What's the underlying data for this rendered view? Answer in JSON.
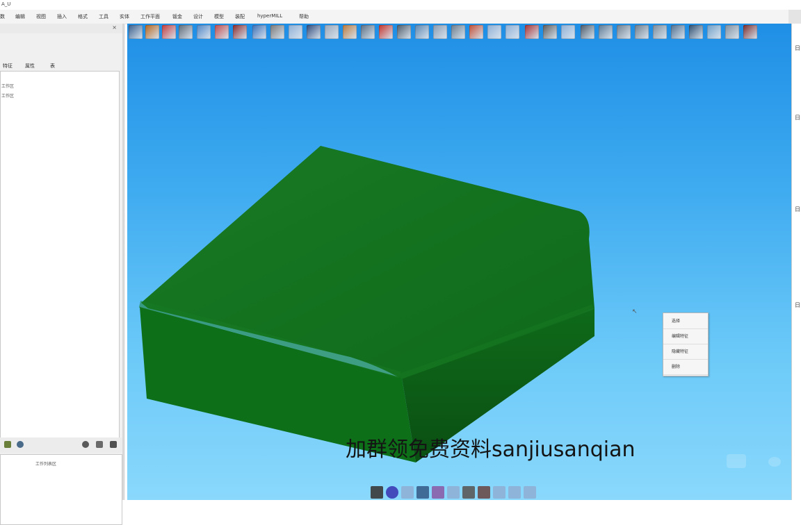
{
  "window": {
    "title": "A_U"
  },
  "menu": {
    "items": [
      "数",
      "编辑",
      "视图",
      "插入",
      "格式",
      "工具",
      "实体",
      "工作平面",
      "钣金",
      "设计",
      "模型",
      "装配",
      "hyperMILL",
      "帮助"
    ]
  },
  "left_panel": {
    "close_glyph": "×",
    "tabs": [
      "特征",
      "属性",
      "表"
    ],
    "tree_items": [
      "工作区",
      "工作区"
    ],
    "bottom_label": "工作列表区"
  },
  "toolbar": {
    "icons": [
      "save-icon",
      "open-icon",
      "star-icon",
      "tools-icon",
      "rotate-icon",
      "arrow-icon",
      "box-icon",
      "undo-icon",
      "redo-icon",
      "blank-icon",
      "boot-icon",
      "page-icon",
      "solid-icon",
      "layer-icon",
      "paint-icon",
      "sphere-icon",
      "bridge-icon",
      "select-icon",
      "cut-icon",
      "trim-icon",
      "blank-icon",
      "blank-icon",
      "cube-icon",
      "pin-icon",
      "blank-icon",
      "shield-icon",
      "zoom-icon",
      "tools-icon",
      "cube-frame-icon",
      "grid-icon",
      "sync-icon",
      "orbit-icon",
      "target-icon",
      "minus-icon",
      "fit-icon"
    ],
    "colors": [
      "#3a5f8c",
      "#b5651d",
      "#c23b3b",
      "#606b78",
      "#4f86c6",
      "#c14b4b",
      "#8b2b2b",
      "#3b6fb6",
      "#7a7a7a",
      "#8fb0d6",
      "#2f4a7a",
      "#9aa7b8",
      "#b97a3e",
      "#5b6f84",
      "#c4332c",
      "#4e5b68",
      "#5b86b0",
      "#8a9bb0",
      "#6c7c8c",
      "#c24f35",
      "#8fb0d6",
      "#8fb0d6",
      "#a83232",
      "#5b5b5b",
      "#8fb0d6",
      "#4b5a6a",
      "#5d7a94",
      "#6f7f8f",
      "#6d7d8d",
      "#7b8b9b",
      "#4f6f8f",
      "#2f4f6f",
      "#6fa0c8",
      "#7f8f9f",
      "#7a2d2d"
    ]
  },
  "context_menu": {
    "items": [
      "选择",
      "编辑特征",
      "隐藏特征",
      "删除"
    ]
  },
  "cursor_glyph": "↖",
  "watermark": "加群领免费资料sanjiusanqian",
  "bottom_toolbar": {
    "icons": [
      "solid-icon",
      "globe-icon",
      "blank-icon",
      "pen-icon",
      "pen-icon",
      "blank-icon",
      "brush-icon",
      "pin-icon",
      "blank-icon",
      "blank-icon",
      "blank-icon"
    ],
    "colors": [
      "#3a3a3a",
      "#3b3bb5",
      "#8fb0d6",
      "#3a5f8c",
      "#8b5ea8",
      "#8fb0d6",
      "#5a5a5a",
      "#6a4a4a",
      "#8fb0d6",
      "#8fb0d6",
      "#8fb0d6"
    ]
  },
  "right_panel": {
    "marks": [
      "日",
      "日",
      "日",
      "日"
    ]
  },
  "model": {
    "top_color": "#0f6a1a",
    "left_color": "#0d6f18",
    "right_color": "#0a4f12",
    "edge_highlight": "#187a24"
  }
}
